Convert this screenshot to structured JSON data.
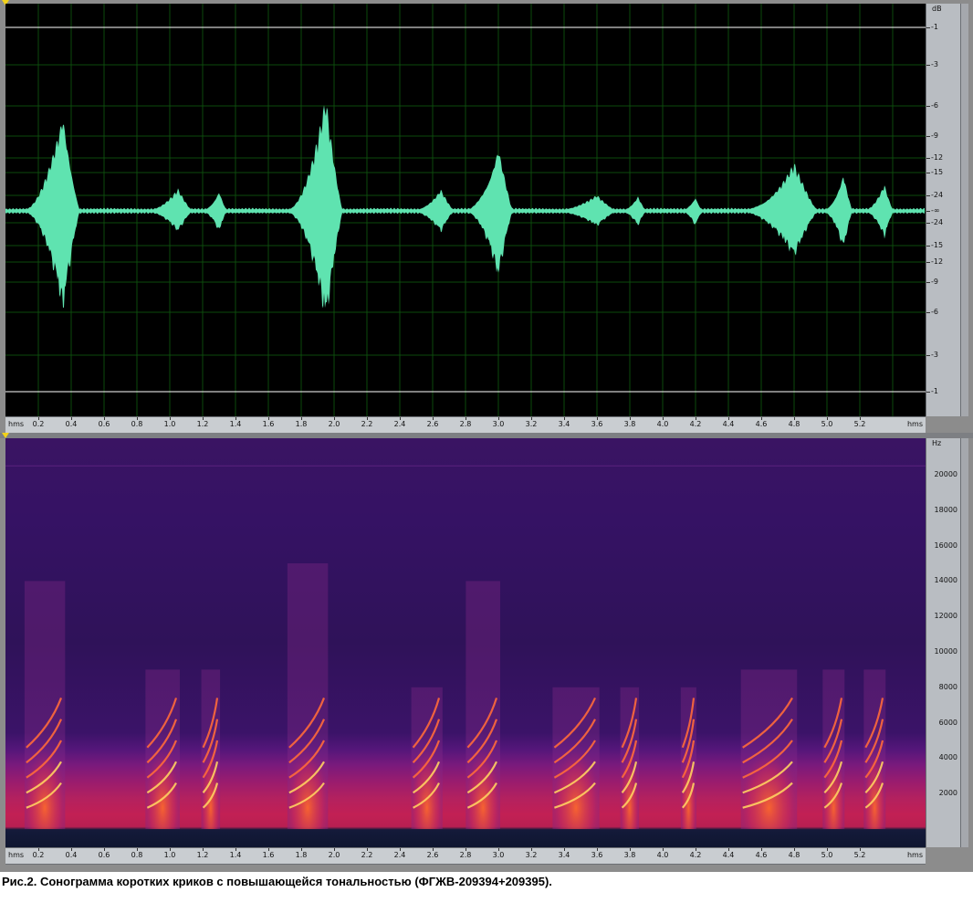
{
  "waveform": {
    "db_unit": "dB",
    "db_labels": [
      "-1",
      "-3",
      "-6",
      "-9",
      "-12",
      "-15",
      "-24",
      "-∞",
      "-24",
      "-15",
      "-12",
      "-9",
      "-6",
      "-3",
      "-1"
    ]
  },
  "time_ruler": {
    "unit": "hms",
    "labels": [
      "0.2",
      "0.4",
      "0.6",
      "0.8",
      "1.0",
      "1.2",
      "1.4",
      "1.6",
      "1.8",
      "2.0",
      "2.2",
      "2.4",
      "2.6",
      "2.8",
      "3.0",
      "3.2",
      "3.4",
      "3.6",
      "3.8",
      "4.0",
      "4.2",
      "4.4",
      "4.6",
      "4.8",
      "5.0",
      "5.2"
    ]
  },
  "spectrogram": {
    "hz_unit": "Hz",
    "hz_labels": [
      "20000",
      "18000",
      "16000",
      "14000",
      "12000",
      "10000",
      "8000",
      "6000",
      "4000",
      "2000"
    ]
  },
  "calls": [
    {
      "time_s": 0.35,
      "amp": 0.52,
      "width_s": 0.26,
      "peak_khz": 14
    },
    {
      "time_s": 1.05,
      "amp": 0.11,
      "width_s": 0.22,
      "peak_khz": 9
    },
    {
      "time_s": 1.3,
      "amp": 0.11,
      "width_s": 0.12,
      "peak_khz": 9
    },
    {
      "time_s": 1.95,
      "amp": 0.58,
      "width_s": 0.26,
      "peak_khz": 15
    },
    {
      "time_s": 2.65,
      "amp": 0.11,
      "width_s": 0.2,
      "peak_khz": 8
    },
    {
      "time_s": 3.0,
      "amp": 0.35,
      "width_s": 0.22,
      "peak_khz": 14
    },
    {
      "time_s": 3.6,
      "amp": 0.08,
      "width_s": 0.3,
      "peak_khz": 8
    },
    {
      "time_s": 3.85,
      "amp": 0.08,
      "width_s": 0.12,
      "peak_khz": 8
    },
    {
      "time_s": 4.2,
      "amp": 0.08,
      "width_s": 0.1,
      "peak_khz": 8
    },
    {
      "time_s": 4.8,
      "amp": 0.24,
      "width_s": 0.36,
      "peak_khz": 9
    },
    {
      "time_s": 5.1,
      "amp": 0.2,
      "width_s": 0.14,
      "peak_khz": 9
    },
    {
      "time_s": 5.35,
      "amp": 0.14,
      "width_s": 0.14,
      "peak_khz": 9
    }
  ],
  "colors": {
    "waveform": "#5fe3b0",
    "grid": "#0d4a0d",
    "clip_line": "#ffffff"
  },
  "caption": "Рис.2. Сонограмма коротких криков с повышающейся тональностью (ФГЖВ-209394+209395)."
}
